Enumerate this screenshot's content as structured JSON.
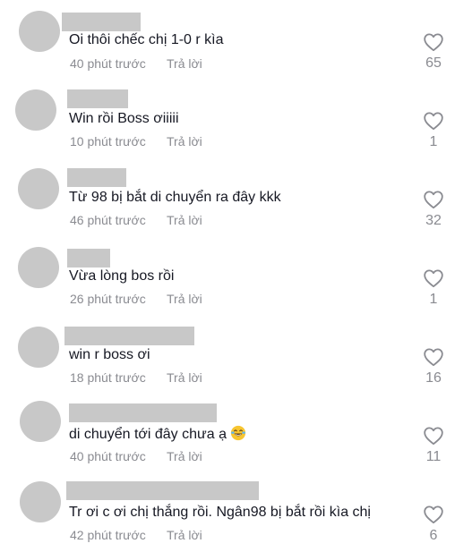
{
  "comments": [
    {
      "text": "Oi thôi chếc chị 1-0 r kìa",
      "time": "40 phút trước",
      "reply": "Trả lời",
      "likes": "65"
    },
    {
      "text": "Win rồi Boss ơiiiii",
      "time": "10 phút trước",
      "reply": "Trả lời",
      "likes": "1"
    },
    {
      "text": "Từ 98 bị bắt di chuyển ra đây kkk",
      "time": "46 phút trước",
      "reply": "Trả lời",
      "likes": "32"
    },
    {
      "text": "Vừa lòng bos rồi",
      "time": "26 phút trước",
      "reply": "Trả lời",
      "likes": "1"
    },
    {
      "text": "win r boss ơi",
      "time": "18 phút trước",
      "reply": "Trả lời",
      "likes": "16"
    },
    {
      "text": "di chuyển tới đây chưa ạ",
      "time": "40 phút trước",
      "reply": "Trả lời",
      "likes": "11",
      "emoji": "laughing-tears-emoji"
    },
    {
      "text": "Tr ơi c ơi chị thắng rồi. Ngân98 bị bắt rồi kìa chị",
      "time": "42 phút trước",
      "reply": "Trả lời",
      "likes": "6"
    }
  ],
  "icons": {
    "like": "heart-outline-icon",
    "avatar_placeholder_color": "#c8c8c8",
    "text_color": "#161823",
    "meta_color": "#8a8b91"
  }
}
